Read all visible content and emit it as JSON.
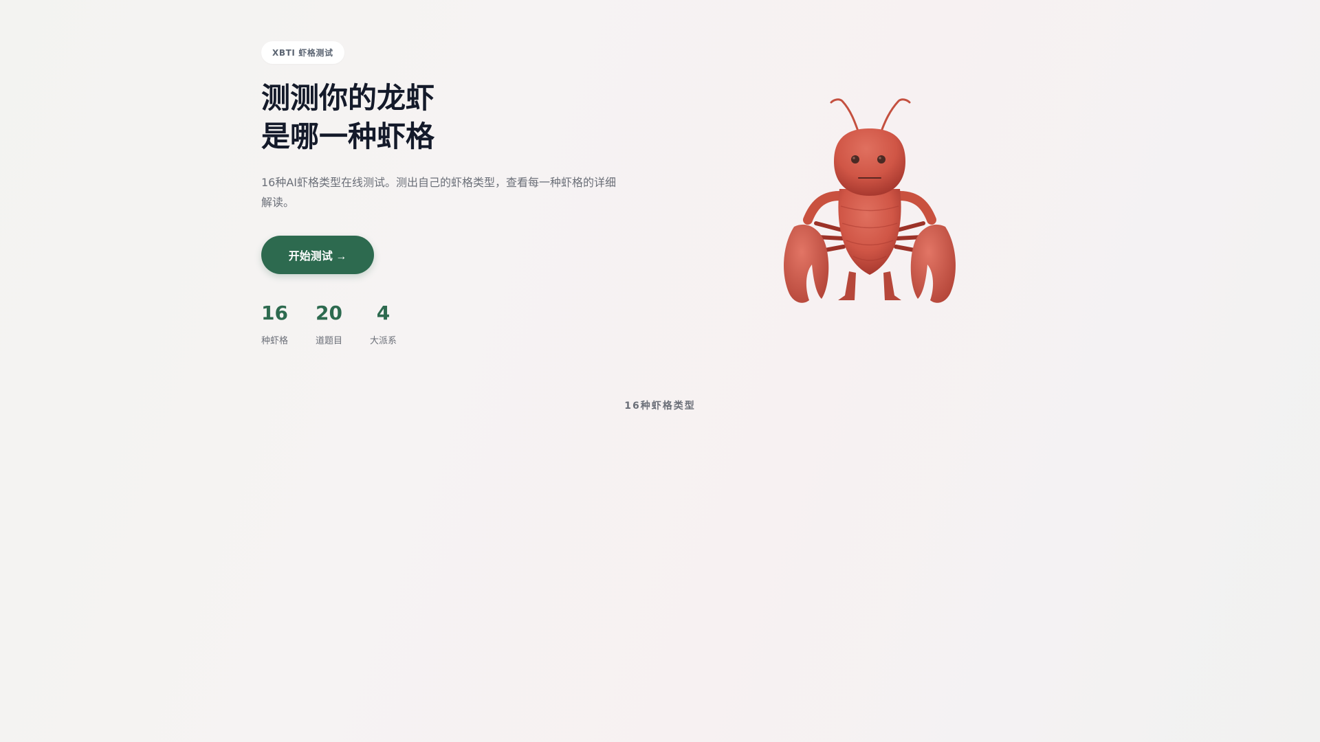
{
  "hero": {
    "badge": "XBTI 虾格测试",
    "title_line1": "测测你的龙虾",
    "title_line2": "是哪一种虾格",
    "subtitle": "16种AI虾格类型在线测试。测出自己的虾格类型，查看每一种虾格的详细解读。",
    "cta_label": "开始测试 →"
  },
  "stats": [
    {
      "value": "16",
      "label": "种虾格"
    },
    {
      "value": "20",
      "label": "道题目"
    },
    {
      "value": "4",
      "label": "大派系"
    }
  ],
  "types_section": {
    "heading": "16种虾格类型"
  },
  "colors": {
    "accent": "#2d6a4f",
    "title": "#141a2a",
    "muted": "#6b6f78",
    "lobster": "#d65a4a"
  },
  "mascot": {
    "icon": "lobster-icon"
  }
}
